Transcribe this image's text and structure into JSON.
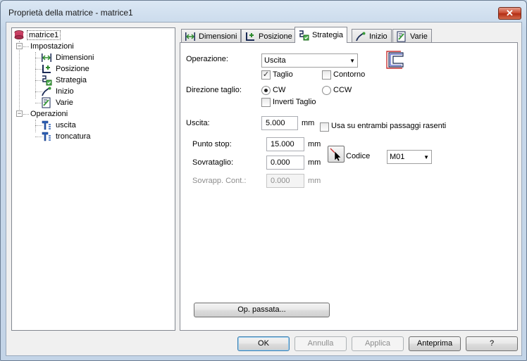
{
  "window": {
    "title": "Proprietà della matrice - matrice1",
    "close_label": "✕"
  },
  "tree": {
    "root": "matrice1",
    "groups": [
      {
        "label": "Impostazioni",
        "expander": "−",
        "items": [
          "Dimensioni",
          "Posizione",
          "Strategia",
          "Inizio",
          "Varie"
        ]
      },
      {
        "label": "Operazioni",
        "expander": "−",
        "items": [
          "uscita",
          "troncatura"
        ]
      }
    ]
  },
  "tabs": [
    {
      "label": "Dimensioni",
      "icon": "dimension-icon",
      "active": false
    },
    {
      "label": "Posizione",
      "icon": "position-icon",
      "active": false
    },
    {
      "label": "Strategia",
      "icon": "strategy-icon",
      "active": true
    },
    {
      "label": "Inizio",
      "icon": "start-icon",
      "active": false
    },
    {
      "label": "Varie",
      "icon": "misc-icon",
      "active": false
    }
  ],
  "form": {
    "operazione_label": "Operazione:",
    "operazione_value": "Uscita",
    "taglio_label": "Taglio",
    "taglio_checked": true,
    "contorno_label": "Contorno",
    "contorno_checked": false,
    "direzione_label": "Direzione taglio:",
    "cw_label": "CW",
    "ccw_label": "CCW",
    "direction_selected": "CW",
    "inverti_label": "Inverti Taglio",
    "inverti_checked": false,
    "uscita_label": "Uscita:",
    "uscita_value": "5.000",
    "uscita_unit": "mm",
    "usa_label": "Usa su entrambi passaggi rasenti",
    "usa_checked": false,
    "punto_stop_label": "Punto stop:",
    "punto_stop_value": "15.000",
    "punto_stop_unit": "mm",
    "sovrataglio_label": "Sovrataglio:",
    "sovrataglio_value": "0.000",
    "sovrataglio_unit": "mm",
    "sovrapp_label": "Sovrapp. Cont.:",
    "sovrapp_value": "0.000",
    "sovrapp_unit": "mm",
    "codice_label": "Codice",
    "codice_value": "M01",
    "op_passata_label": "Op. passata..."
  },
  "footer": {
    "ok": "OK",
    "annulla": "Annulla",
    "applica": "Applica",
    "anteprima": "Anteprima",
    "help": "?"
  },
  "colors": {
    "accent": "#3c7fb1",
    "titlebar": "#c7d8ea",
    "close": "#c7442a"
  }
}
